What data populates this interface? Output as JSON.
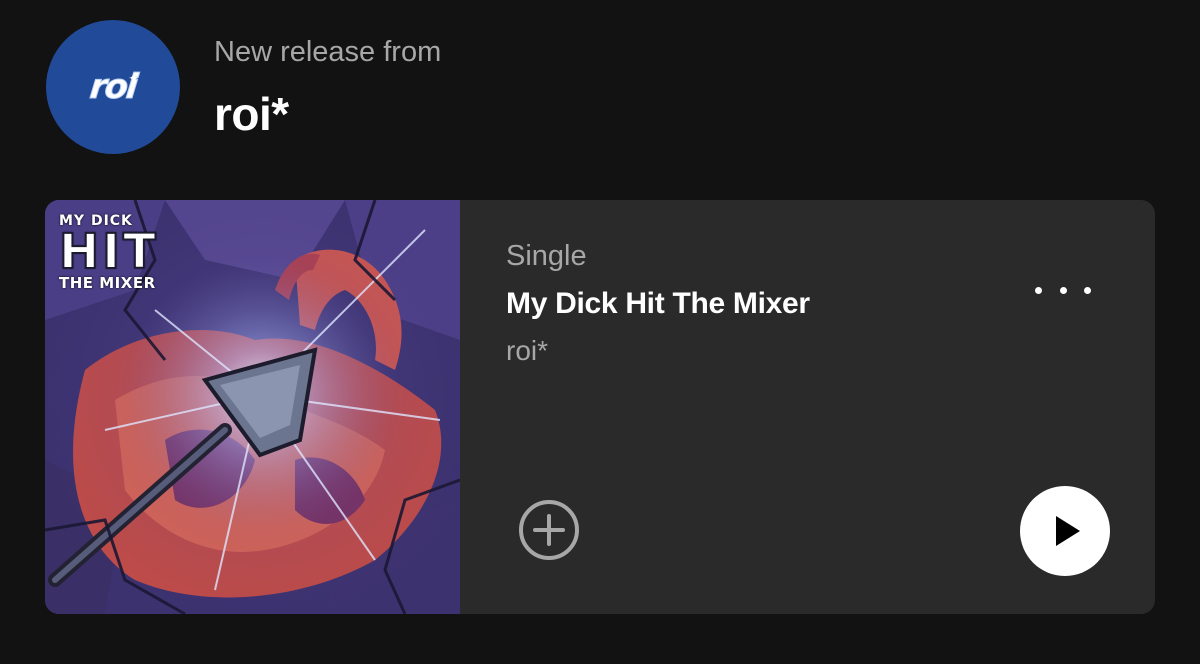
{
  "header": {
    "avatar_text": "roi",
    "release_label": "New release from",
    "artist_name": "roi*"
  },
  "release": {
    "type": "Single",
    "title": "My Dick Hit The Mixer",
    "artist": "roi*",
    "cover_art": {
      "line1": "MY DICK",
      "line2": "HIT",
      "line3": "THE MIXER"
    }
  },
  "icons": {
    "more": "more-options-icon",
    "add": "add-circle-icon",
    "play": "play-icon"
  },
  "colors": {
    "background": "#121212",
    "card": "#2a2a2a",
    "avatar": "#214a98",
    "secondary_text": "#a7a7a7"
  }
}
